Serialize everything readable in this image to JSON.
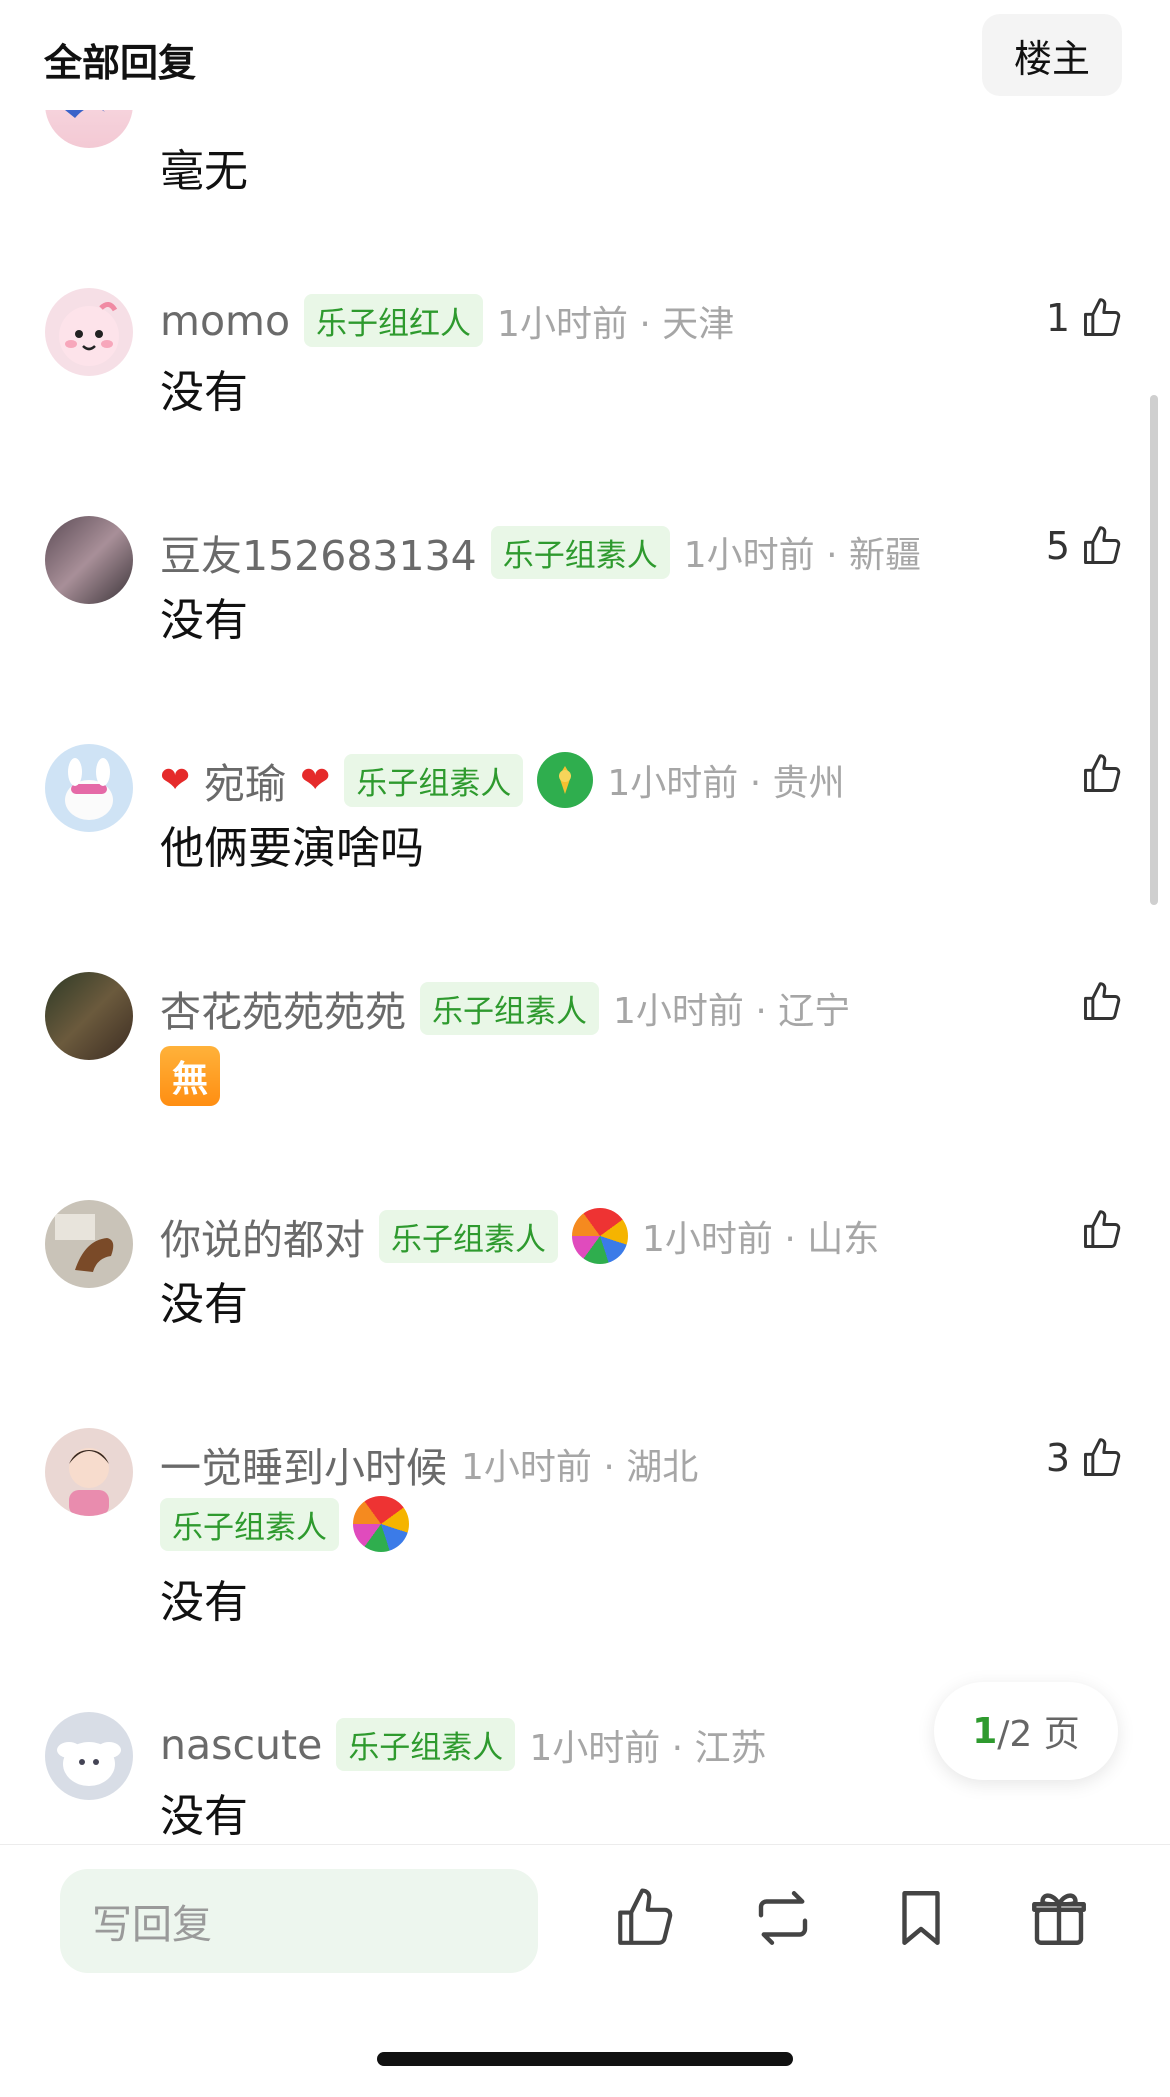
{
  "header": {
    "title": "全部回复",
    "op_label": "楼主"
  },
  "top_comment": {
    "text": "毫无"
  },
  "comments": [
    {
      "name": "momo",
      "badge": "乐子组红人",
      "meta": "1小时前 · 天津",
      "text": "没有",
      "likes": "1"
    },
    {
      "name": "豆友152683134",
      "badge": "乐子组素人",
      "meta": "1小时前 · 新疆",
      "text": "没有",
      "likes": "5"
    },
    {
      "name": "宛瑜",
      "badge": "乐子组素人",
      "meta": "1小时前 · 贵州",
      "text": "他俩要演啥吗",
      "likes": ""
    },
    {
      "name": "杏花苑苑苑苑",
      "badge": "乐子组素人",
      "meta": "1小时前 · 辽宁",
      "text": "無",
      "likes": ""
    },
    {
      "name": "你说的都对",
      "badge": "乐子组素人",
      "meta": "1小时前 · 山东",
      "text": "没有",
      "likes": ""
    },
    {
      "name": "一觉睡到小时候",
      "badge": "乐子组素人",
      "meta": "1小时前 · 湖北",
      "text": "没有",
      "likes": "3"
    },
    {
      "name": "nascute",
      "badge": "乐子组素人",
      "meta": "1小时前 · 江苏",
      "text": "没有",
      "likes": ""
    }
  ],
  "pager": {
    "current": "1",
    "total_text": "/2 页"
  },
  "bottom_bar": {
    "reply_placeholder": "写回复",
    "icons": [
      "thumbs-up-icon",
      "repost-icon",
      "bookmark-icon",
      "gift-icon"
    ]
  },
  "colors": {
    "badge_bg": "#e9f7e7",
    "badge_text": "#2e9a2e",
    "reply_bg": "#edf6ee"
  }
}
